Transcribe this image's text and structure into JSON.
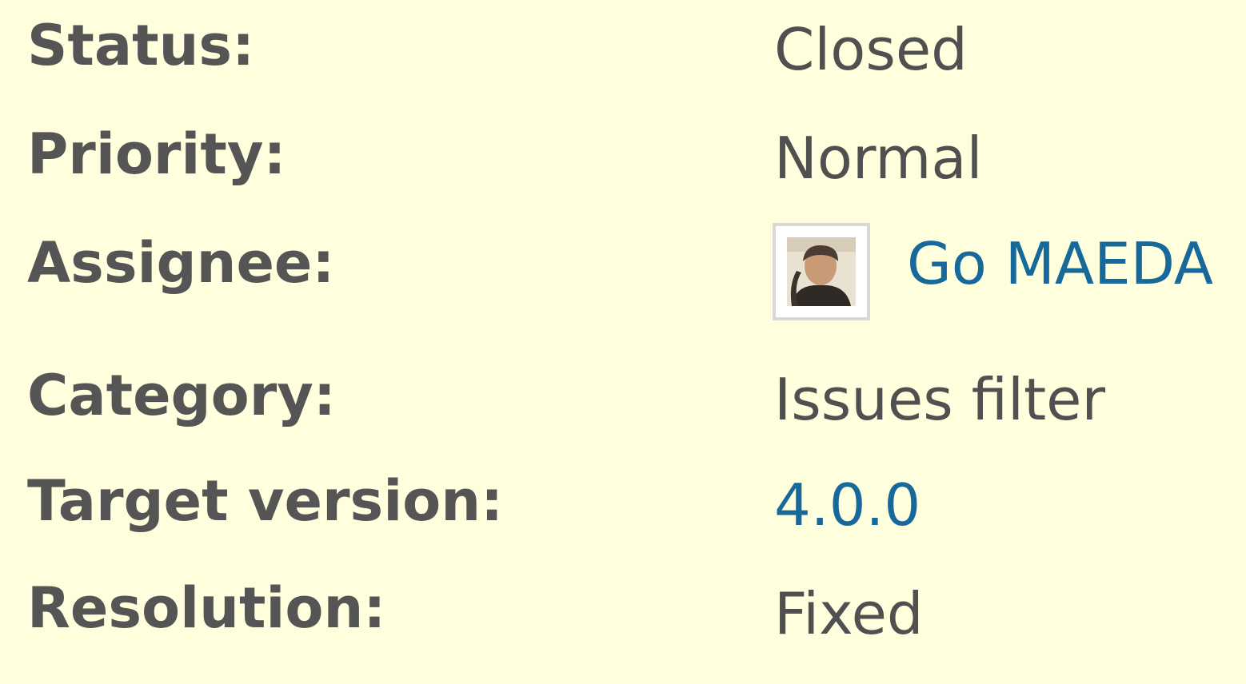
{
  "issue_attributes": {
    "status": {
      "label": "Status:",
      "value": "Closed"
    },
    "priority": {
      "label": "Priority:",
      "value": "Normal"
    },
    "assignee": {
      "label": "Assignee:",
      "value": "Go MAEDA",
      "avatar_icon": "user-avatar"
    },
    "category": {
      "label": "Category:",
      "value": "Issues filter"
    },
    "target_version": {
      "label": "Target version:",
      "value": "4.0.0"
    },
    "resolution": {
      "label": "Resolution:",
      "value": "Fixed"
    }
  },
  "colors": {
    "background": "#ffffdd",
    "label_text": "#555555",
    "value_text": "#505050",
    "link": "#16699a",
    "avatar_border": "#d8d8d8"
  }
}
